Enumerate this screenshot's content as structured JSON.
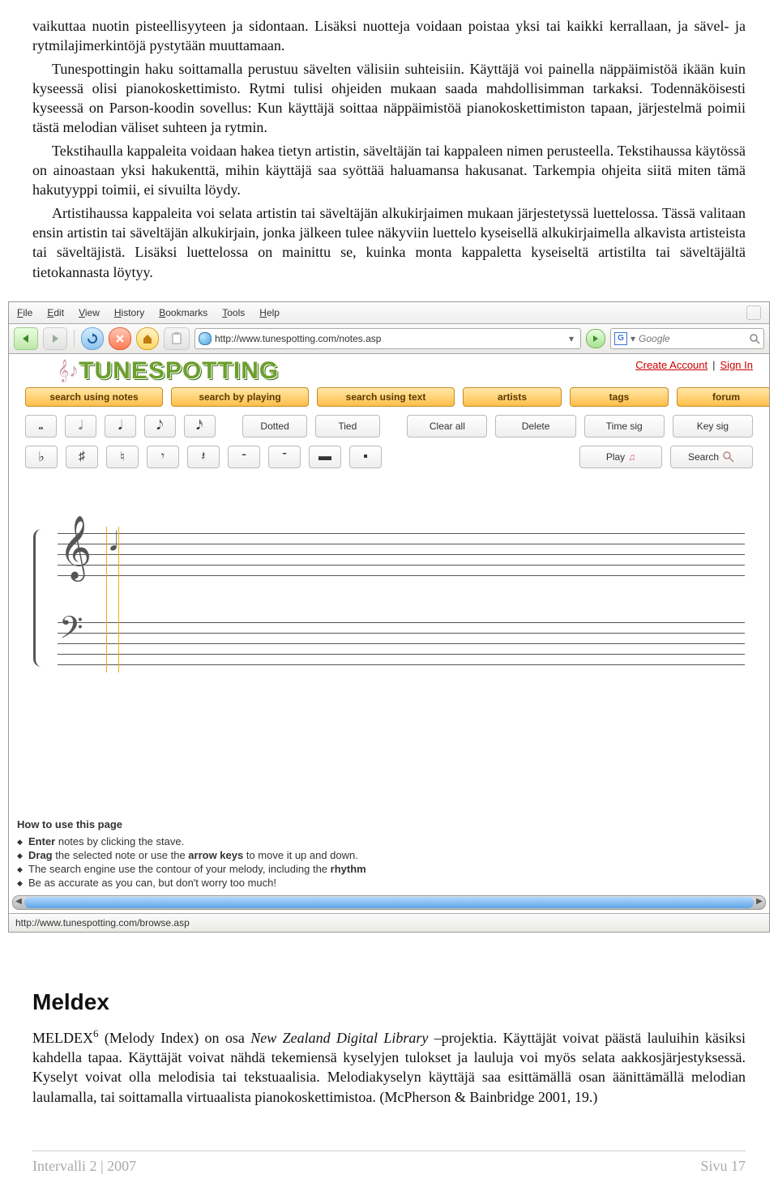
{
  "doc": {
    "p1": "vaikuttaa nuotin pisteellisyyteen ja sidontaan. Lisäksi nuotteja voidaan poistaa yksi tai kaikki kerrallaan, ja sävel- ja rytmilajimerkintöjä pystytään muuttamaan.",
    "p2": "Tunespottingin haku soittamalla perustuu sävelten välisiin suhteisiin. Käyttäjä voi painella näppäimistöä ikään kuin kyseessä olisi pianokoskettimisto. Rytmi tulisi ohjeiden mukaan saada mahdollisimman tarkaksi. Todennäköisesti kyseessä on Parson-koodin sovellus: Kun käyttäjä soittaa näppäimistöä pianokoskettimiston tapaan, järjestelmä poimii tästä melodian väliset suhteen ja rytmin.",
    "p3": "Tekstihaulla kappaleita voidaan hakea tietyn artistin, säveltäjän tai kappaleen nimen perusteella. Tekstihaussa käytössä on ainoastaan yksi hakukenttä, mihin käyttäjä saa syöttää haluamansa hakusanat. Tarkempia ohjeita siitä miten tämä hakutyyppi toimii, ei sivuilta löydy.",
    "p4": "Artistihaussa kappaleita voi selata artistin tai säveltäjän alkukirjaimen mukaan järjestetyssä luettelossa. Tässä valitaan ensin artistin tai säveltäjän alkukirjain, jonka jälkeen tulee näkyviin luettelo kyseisellä alkukirjaimella alkavista artisteista tai säveltäjistä. Lisäksi luettelossa on mainittu se, kuinka monta kappaletta kyseiseltä artistilta tai säveltäjältä tietokannasta löytyy."
  },
  "browser": {
    "menu": [
      "File",
      "Edit",
      "View",
      "History",
      "Bookmarks",
      "Tools",
      "Help"
    ],
    "url": "http://www.tunespotting.com/notes.asp",
    "search_placeholder": "Google",
    "status": "http://www.tunespotting.com/browse.asp"
  },
  "page": {
    "create": "Create Account",
    "signin": "Sign In",
    "logo": "TUNESPOTTING",
    "tabs_primary": [
      "search using notes",
      "search by playing",
      "search using text"
    ],
    "tabs_secondary": [
      "artists",
      "tags",
      "forum"
    ],
    "note_tools": [
      "𝅝",
      "𝅗𝅥",
      "𝅘𝅥",
      "𝅘𝅥𝅮",
      "𝅘𝅥𝅯"
    ],
    "note_attr": [
      "Dotted",
      "Tied"
    ],
    "edit_btns": [
      "Clear all",
      "Delete",
      "Time sig",
      "Key sig"
    ],
    "action_btns": [
      "Play",
      "Search"
    ],
    "acc_tools": [
      "♭",
      "♯",
      "♮",
      "𝄾",
      "𝄽",
      "𝄼",
      "𝄻",
      "▬",
      "▪"
    ],
    "howto_title": "How to use this page",
    "howto": [
      {
        "pre": "Enter",
        "post": " notes by clicking the stave."
      },
      {
        "pre": "Drag",
        "mid": " the selected note or use the ",
        "b2": "arrow keys",
        "post": " to move it up and down."
      },
      {
        "pre": "",
        "mid": "The search engine use the contour of your melody, including the ",
        "b2": "rhythm",
        "post": ""
      },
      {
        "pre": "",
        "mid": "Be as accurate as you can, but don't worry too much!",
        "b2": "",
        "post": ""
      }
    ]
  },
  "meldex": {
    "heading": "Meldex",
    "body_pre": "MELDEX",
    "ref": "6",
    "body_mid1": " (Melody Index) on osa ",
    "body_ital": "New Zealand Digital Library",
    "body_mid2": " –projektia. Käyttäjät voivat päästä lauluihin käsiksi kahdella tapaa. Käyttäjät voivat nähdä tekemiensä kyselyjen tulokset ja lauluja voi myös selata aakkosjärjestyksessä. Kyselyt voivat olla melodisia tai tekstuaalisia. Melodiakyselyn käyttäjä saa esittämällä osan äänittämällä melodian laulamalla, tai soittamalla virtuaalista pianokoskettimistoa. (McPherson & Bainbridge 2001, 19.)"
  },
  "footer": {
    "left": "Intervalli 2 | 2007",
    "right": "Sivu 17"
  }
}
